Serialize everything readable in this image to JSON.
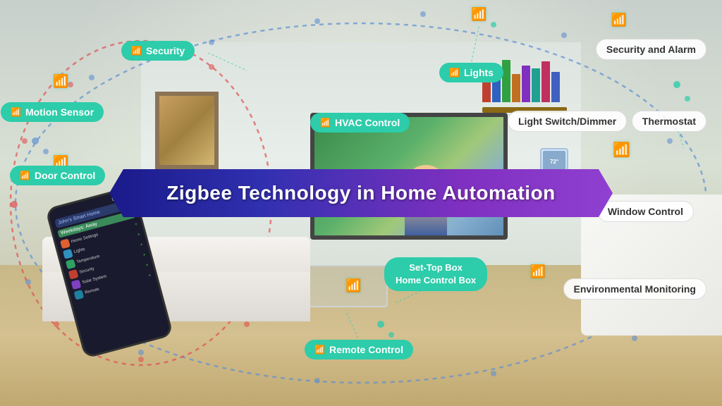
{
  "title": "Zigbee Technology in Home Automation",
  "labels": {
    "security": "Security",
    "motion_sensor": "Motion Sensor",
    "door_control": "Door Control",
    "hvac_control": "HVAC Control",
    "lights": "Lights",
    "light_switch": "Light Switch/Dimmer",
    "security_alarm": "Security and Alarm",
    "thermostat": "Thermostat",
    "window_control": "Window Control",
    "set_top_box_line1": "Set-Top Box",
    "set_top_box_line2": "Home Control Box",
    "remote_control": "Remote Control",
    "environmental": "Environmental Monitoring"
  },
  "phone": {
    "time": "9:42 AM",
    "app_title": "John's Smart Home",
    "mode": "Weekdays: Away",
    "rows": [
      {
        "icon_color": "#e06030",
        "label": "Home Settings"
      },
      {
        "icon_color": "#3090c0",
        "label": "Lights"
      },
      {
        "icon_color": "#30a060",
        "label": "Temperature"
      },
      {
        "icon_color": "#c04030",
        "label": "Security"
      },
      {
        "icon_color": "#8040c0",
        "label": "Solar System"
      },
      {
        "icon_color": "#2080a0",
        "label": "Remote"
      }
    ]
  },
  "colors": {
    "teal": "#2dccaa",
    "light_teal": "#6de8c8",
    "banner_left": "#1a1a8a",
    "banner_right": "#9040d0",
    "dot_blue": "#6090d0",
    "dot_red": "#e05050",
    "dot_green": "#50c080"
  }
}
